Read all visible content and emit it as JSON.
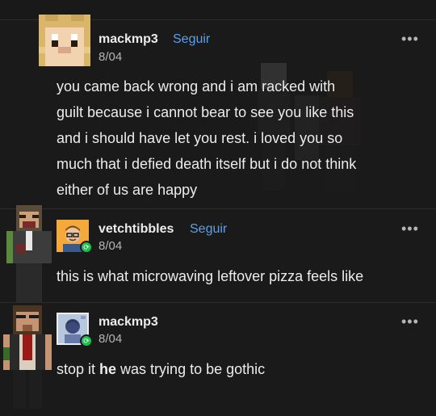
{
  "posts": [
    {
      "username": "mackmp3",
      "follow_label": "Seguir",
      "date": "8/04",
      "more_label": "•••",
      "body_lines": [
        "you came back wrong and i am racked with",
        "guilt because i cannot bear to see you like this",
        "and i should have let you rest. i loved you so",
        "much that i defied death itself but i do not think",
        "either of us are happy"
      ]
    },
    {
      "username": "vetchtibbles",
      "follow_label": "Seguir",
      "date": "8/04",
      "more_label": "•••",
      "body": "this is what microwaving leftover pizza feels like"
    },
    {
      "username": "mackmp3",
      "date": "8/04",
      "more_label": "•••",
      "body_prefix": "stop it ",
      "body_bold": "he",
      "body_suffix": " was trying to be gothic"
    }
  ],
  "colors": {
    "background": "#1a1a1b",
    "follow": "#5aa1e8",
    "reblog_badge": "#1fbf4f"
  }
}
